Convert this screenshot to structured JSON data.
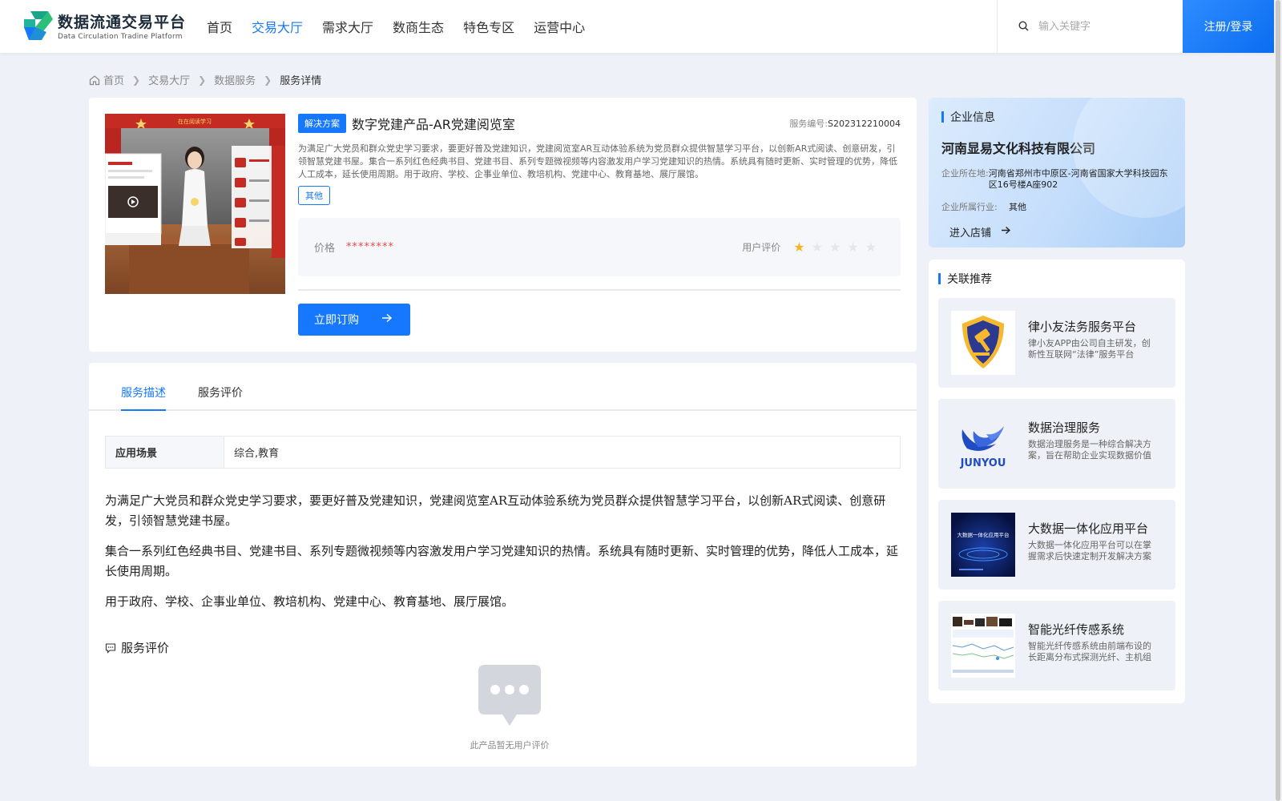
{
  "header": {
    "logo_title": "数据流通交易平台",
    "logo_subtitle": "Data Circulation Tradine Platform",
    "nav": [
      "首页",
      "交易大厅",
      "需求大厅",
      "数商生态",
      "特色专区",
      "运营中心"
    ],
    "active_nav": "交易大厅",
    "search_placeholder": "输入关键字",
    "login_label": "注册/登录"
  },
  "breadcrumb": [
    "首页",
    "交易大厅",
    "数据服务",
    "服务详情"
  ],
  "product": {
    "tag": "解决方案",
    "title": "数字党建产品-AR党建阅览室",
    "service_no_label": "服务编号:",
    "service_no": "S202312210004",
    "description": "为满足广大党员和群众党史学习要求，要更好普及党建知识，党建阅览室AR互动体验系统为党员群众提供智慧学习平台，以创新AR式阅读、创意研发，引领智慧党建书屋。集合一系列红色经典书目、党建书目、系列专题微视频等内容激发用户学习党建知识的热情。系统具有随时更新、实时管理的优势，降低人工成本，延长使用周期。用于政府、学校、企事业单位、教培机构、党建中心、教育基地、展厅展馆。",
    "category_tag": "其他",
    "price_label": "价格",
    "price_value": "********",
    "rating_label": "用户评价",
    "rating": 1,
    "rating_max": 5,
    "order_label": "立即订购",
    "image_caption": "在在阅读学习",
    "accent_color": "#1677ff"
  },
  "detail": {
    "tabs": [
      "服务描述",
      "服务评价"
    ],
    "active_tab": "服务描述",
    "scene_key": "应用场景",
    "scene_value": "综合,教育",
    "paragraphs": [
      "为满足广大党员和群众党史学习要求，要更好普及党建知识，党建阅览室AR互动体验系统为党员群众提供智慧学习平台，以创新AR式阅读、创意研发，引领智慧党建书屋。",
      "集合一系列红色经典书目、党建书目、系列专题微视频等内容激发用户学习党建知识的热情。系统具有随时更新、实时管理的优势，降低人工成本，延长使用周期。",
      "用于政府、学校、企事业单位、教培机构、党建中心、教育基地、展厅展馆。"
    ],
    "eval_title": "服务评价",
    "eval_empty": "此产品暂无用户评价"
  },
  "company": {
    "section_title": "企业信息",
    "name": "河南显易文化科技有限公司",
    "location_label": "企业所在地:",
    "location": "河南省郑州市中原区-河南省国家大学科技园东区16号楼A座902",
    "industry_label": "企业所属行业:",
    "industry": "其他",
    "shop_label": "进入店铺"
  },
  "recommend": {
    "section_title": "关联推荐",
    "items": [
      {
        "title": "律小友法务服务平台",
        "desc": "律小友APP由公司自主研发，创新性互联网“法律”服务平台",
        "icon": "law-shield-icon"
      },
      {
        "title": "数据治理服务",
        "desc": "数据治理服务是一种综合解决方案，旨在帮助企业实现数据价值",
        "icon": "junyou-logo",
        "logo_text": "JUNYOU"
      },
      {
        "title": "大数据一体化应用平台",
        "desc": "大数据一体化应用平台可以在掌握需求后快速定制开发解决方案",
        "icon": "bigdata-screen",
        "thumb_title": "大数据一体化应用平台"
      },
      {
        "title": "智能光纤传感系统",
        "desc": "智能光纤传感系统由前端布设的长距离分布式探测光纤、主机组成",
        "icon": "fiber-dashboard"
      }
    ]
  }
}
